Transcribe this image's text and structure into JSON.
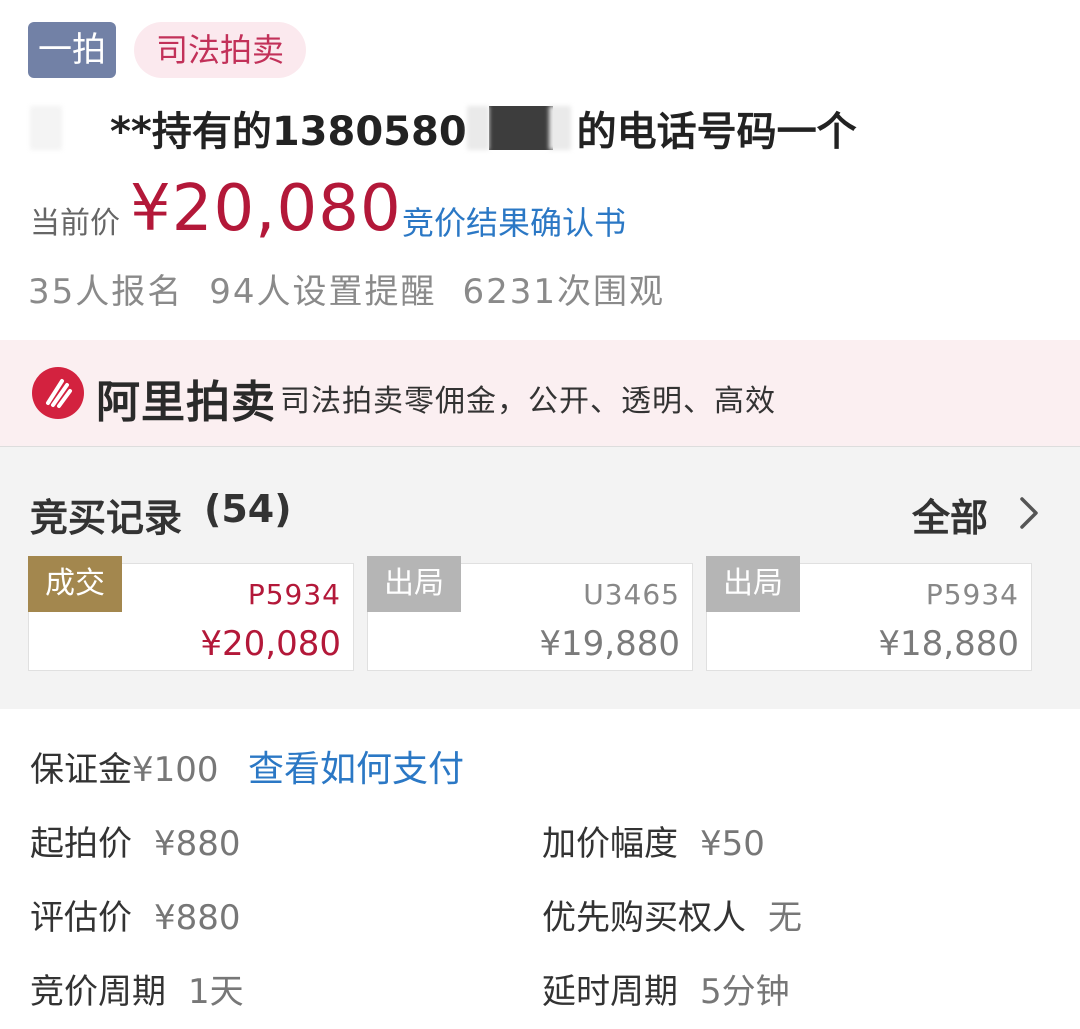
{
  "tags": {
    "round": "一拍",
    "type": "司法拍卖"
  },
  "title": {
    "prefix": "**持有的1380580",
    "suffix": "的电话号码一个"
  },
  "price": {
    "label": "当前价",
    "value": "¥20,080",
    "confirm_link": "竞价结果确认书"
  },
  "stats": {
    "signups": "35人报名",
    "reminders": "94人设置提醒",
    "views": "6231次围观"
  },
  "banner": {
    "brand": "阿里拍卖",
    "slogan": "司法拍卖零佣金，公开、透明、高效"
  },
  "bid_record": {
    "title": "竞买记录",
    "count": "(54)",
    "all_label": "全部",
    "bids": [
      {
        "status": "成交",
        "bidder": "P5934",
        "amount": "¥20,080"
      },
      {
        "status": "出局",
        "bidder": "U3465",
        "amount": "¥19,880"
      },
      {
        "status": "出局",
        "bidder": "P5934",
        "amount": "¥18,880"
      }
    ]
  },
  "deposit": {
    "label": "保证金",
    "value": "¥100",
    "pay_link": "查看如何支付"
  },
  "details": {
    "start_price": {
      "label": "起拍价",
      "value": "¥880"
    },
    "increment": {
      "label": "加价幅度",
      "value": "¥50"
    },
    "appraisal": {
      "label": "评估价",
      "value": "¥880"
    },
    "priority": {
      "label": "优先购买权人",
      "value": "无"
    },
    "period": {
      "label": "竞价周期",
      "value": "1天"
    },
    "extension": {
      "label": "延时周期",
      "value": "5分钟"
    }
  },
  "colors": {
    "accent_red": "#b31839",
    "link_blue": "#2b78c5",
    "win_gold": "#a3874e",
    "out_gray": "#b5b5b5",
    "tag_blue": "#7281a6"
  }
}
